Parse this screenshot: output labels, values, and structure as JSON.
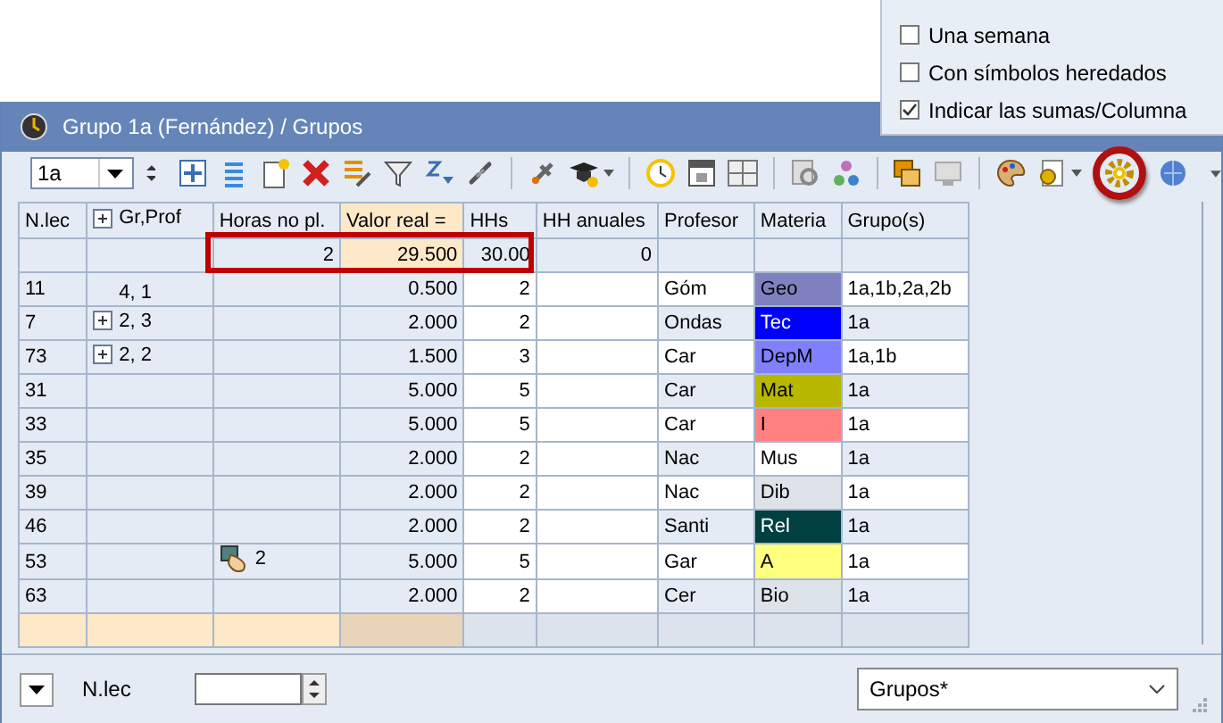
{
  "window": {
    "title": "Grupo 1a (Fernández) / Grupos"
  },
  "toolbar": {
    "class_select": "1a"
  },
  "popup_menu": [
    {
      "label": "Una semana",
      "checked": false
    },
    {
      "label": "Con símbolos heredados",
      "checked": false
    },
    {
      "label": "Indicar las sumas/Columna",
      "checked": true
    }
  ],
  "table": {
    "columns": [
      {
        "label": "N.lec",
        "expandable": false
      },
      {
        "label": "Gr,Prof",
        "expandable": true
      },
      {
        "label": "Horas no pl.",
        "expandable": false
      },
      {
        "label": "Valor real =",
        "expandable": false
      },
      {
        "label": "HHs",
        "expandable": false
      },
      {
        "label": "HH anuales",
        "expandable": false
      },
      {
        "label": "Profesor",
        "expandable": false
      },
      {
        "label": "Materia",
        "expandable": false
      },
      {
        "label": "Grupo(s)",
        "expandable": false
      }
    ],
    "sums": {
      "horas": "2",
      "valor": "29.500",
      "hhs": "30.00",
      "hh_anuales": "0"
    },
    "rows": [
      {
        "nlec": "11",
        "gr_prof": "4, 1",
        "expandable": false,
        "horas": "",
        "pinned": false,
        "valor": "0.500",
        "hhs": "2",
        "profesor": "Góm",
        "materia": "Geo",
        "color": "#8080c0",
        "grupos": "1a,1b,2a,2b"
      },
      {
        "nlec": "7",
        "gr_prof": "2, 3",
        "expandable": true,
        "horas": "",
        "pinned": false,
        "valor": "2.000",
        "hhs": "2",
        "profesor": "Ondas",
        "materia": "Tec",
        "color": "#0000ff",
        "grupos": "1a"
      },
      {
        "nlec": "73",
        "gr_prof": "2, 2",
        "expandable": true,
        "horas": "",
        "pinned": false,
        "valor": "1.500",
        "hhs": "3",
        "profesor": "Car",
        "materia": "DepM",
        "color": "#8080ff",
        "grupos": "1a,1b"
      },
      {
        "nlec": "31",
        "gr_prof": "",
        "expandable": false,
        "horas": "",
        "pinned": false,
        "valor": "5.000",
        "hhs": "5",
        "profesor": "Car",
        "materia": "Mat",
        "color": "#b8b800",
        "grupos": "1a"
      },
      {
        "nlec": "33",
        "gr_prof": "",
        "expandable": false,
        "horas": "",
        "pinned": false,
        "valor": "5.000",
        "hhs": "5",
        "profesor": "Car",
        "materia": "I",
        "color": "#ff8080",
        "grupos": "1a"
      },
      {
        "nlec": "35",
        "gr_prof": "",
        "expandable": false,
        "horas": "",
        "pinned": false,
        "valor": "2.000",
        "hhs": "2",
        "profesor": "Nac",
        "materia": "Mus",
        "color": "#ffffff",
        "grupos": "1a"
      },
      {
        "nlec": "39",
        "gr_prof": "",
        "expandable": false,
        "horas": "",
        "pinned": false,
        "valor": "2.000",
        "hhs": "2",
        "profesor": "Nac",
        "materia": "Dib",
        "color": "#dee3ea",
        "grupos": "1a"
      },
      {
        "nlec": "46",
        "gr_prof": "",
        "expandable": false,
        "horas": "",
        "pinned": false,
        "valor": "2.000",
        "hhs": "2",
        "profesor": "Santi",
        "materia": "Rel",
        "color": "#004040",
        "grupos": "1a"
      },
      {
        "nlec": "53",
        "gr_prof": "",
        "expandable": false,
        "horas": "2",
        "pinned": true,
        "valor": "5.000",
        "hhs": "5",
        "profesor": "Gar",
        "materia": "A",
        "color": "#ffff80",
        "grupos": "1a"
      },
      {
        "nlec": "63",
        "gr_prof": "",
        "expandable": false,
        "horas": "",
        "pinned": false,
        "valor": "2.000",
        "hhs": "2",
        "profesor": "Cer",
        "materia": "Bio",
        "color": "#dee3ea",
        "grupos": "1a"
      }
    ]
  },
  "footer": {
    "field_label": "N.lec",
    "view_select": "Grupos*"
  }
}
